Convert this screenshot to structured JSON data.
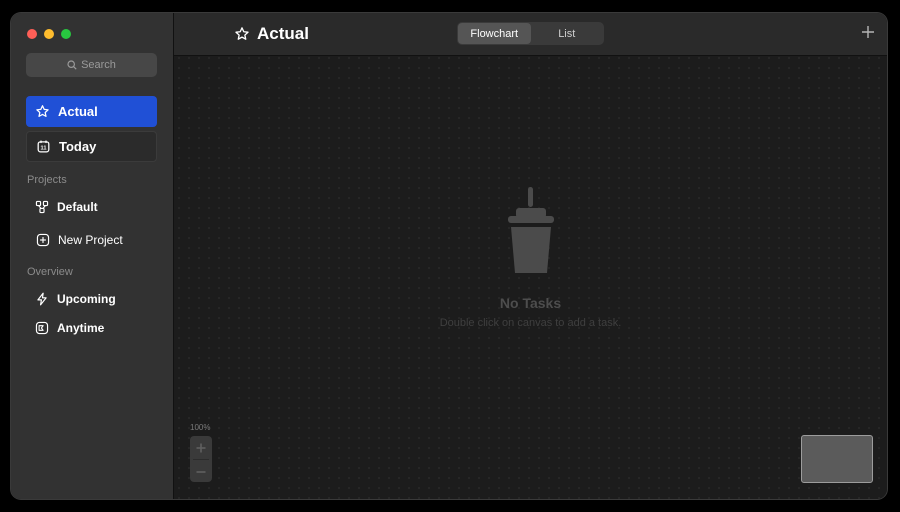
{
  "window": {
    "traffic_colors": [
      "#ff5f57",
      "#febc2e",
      "#28c840"
    ]
  },
  "sidebar": {
    "search_label": "Search",
    "primary": [
      {
        "label": "Actual",
        "icon": "star-icon",
        "active": true
      },
      {
        "label": "Today",
        "icon": "calendar-icon",
        "active": false
      }
    ],
    "projects_heading": "Projects",
    "projects": [
      {
        "label": "Default",
        "icon": "project-nodes-icon"
      },
      {
        "label": "New Project",
        "icon": "plus-square-icon"
      }
    ],
    "overview_heading": "Overview",
    "overview": [
      {
        "label": "Upcoming",
        "icon": "bolt-icon"
      },
      {
        "label": "Anytime",
        "icon": "stack-icon"
      }
    ]
  },
  "toolbar": {
    "title": "Actual",
    "title_icon": "star-icon",
    "segments": [
      "Flowchart",
      "List"
    ],
    "selected_segment": "Flowchart",
    "add_icon": "plus-icon"
  },
  "canvas": {
    "empty_title": "No Tasks",
    "empty_subtitle": "Double click on canvas to add a task.",
    "empty_icon": "cup-icon",
    "zoom_level": "100%"
  },
  "colors": {
    "accent": "#2050d6",
    "sidebar_bg": "#323232",
    "canvas_bg": "#1c1c1c"
  }
}
